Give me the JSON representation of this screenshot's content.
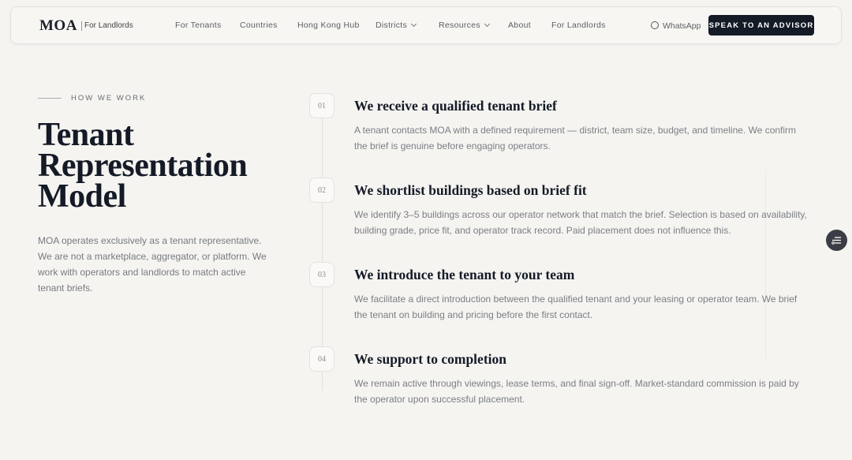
{
  "nav": {
    "logo": "MOA",
    "logo_sub": "For Landlords",
    "links": [
      {
        "label": "For Tenants",
        "dropdown": false
      },
      {
        "label": "Countries",
        "dropdown": false
      },
      {
        "label": "Hong Kong Hub",
        "dropdown": false
      },
      {
        "label": "Districts",
        "dropdown": true
      },
      {
        "label": "Resources",
        "dropdown": true
      },
      {
        "label": "About",
        "dropdown": false
      },
      {
        "label": "For Landlords",
        "dropdown": false
      }
    ],
    "whatsapp": "WhatsApp",
    "cta": "SPEAK TO AN ADVISOR"
  },
  "hero": {
    "eyebrow": "HOW WE WORK",
    "title": "Tenant Representation Model",
    "intro": "MOA operates exclusively as a tenant representative. We are not a marketplace, aggregator, or platform. We work with operators and landlords to match active tenant briefs."
  },
  "steps": [
    {
      "num": "01",
      "title": "We receive a qualified tenant brief",
      "desc": "A tenant contacts MOA with a defined requirement — district, team size, budget, and timeline. We confirm the brief is genuine before engaging operators."
    },
    {
      "num": "02",
      "title": "We shortlist buildings based on brief fit",
      "desc": "We identify 3–5 buildings across our operator network that match the brief. Selection is based on availability, building grade, price fit, and operator track record. Paid placement does not influence this."
    },
    {
      "num": "03",
      "title": "We introduce the tenant to your team",
      "desc": "We facilitate a direct introduction between the qualified tenant and your leasing or operator team. We brief the tenant on building and pricing before the first contact."
    },
    {
      "num": "04",
      "title": "We support to completion",
      "desc": "We remain active through viewings, lease terms, and final sign-off. Market-standard commission is paid by the operator upon successful placement."
    }
  ],
  "floating": {
    "icon": "filter-list-icon"
  },
  "colors": {
    "background": "#f5f4f1",
    "cta": "#141a26",
    "title": "#141a26"
  }
}
